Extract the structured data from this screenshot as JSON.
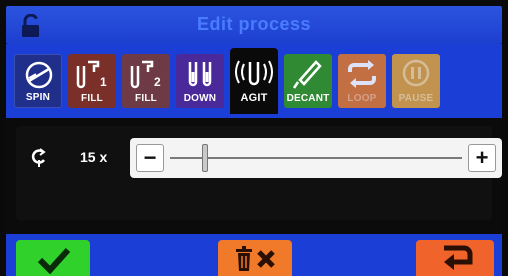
{
  "header": {
    "title": "Edit process"
  },
  "steps": [
    {
      "label": "SPIN",
      "icon": "centrifuge-icon",
      "color": "#1f2f8a"
    },
    {
      "label": "FILL",
      "icon": "tube-fill-1-icon",
      "color": "#7a2f28"
    },
    {
      "label": "FILL",
      "icon": "tube-fill-2-icon",
      "color": "#6e3a45"
    },
    {
      "label": "DOWN",
      "icon": "tubes-down-icon",
      "color": "#4a2a9a"
    },
    {
      "label": "AGIT",
      "icon": "agitate-icon",
      "color": "#0a0a0a"
    },
    {
      "label": "DECANT",
      "icon": "decant-icon",
      "color": "#2f8a33"
    },
    {
      "label": "LOOP",
      "icon": "loop-icon",
      "color": "#e0792a"
    },
    {
      "label": "PAUSE",
      "icon": "pause-icon",
      "color": "#e0a238"
    }
  ],
  "setting": {
    "count": "15 x",
    "minus": "−",
    "plus": "+",
    "slider_value_fraction": 0.12
  },
  "footer": {
    "ok_icon": "checkmark-icon",
    "delete_icon": "trash-x-icon",
    "back_icon": "return-arrow-icon"
  }
}
